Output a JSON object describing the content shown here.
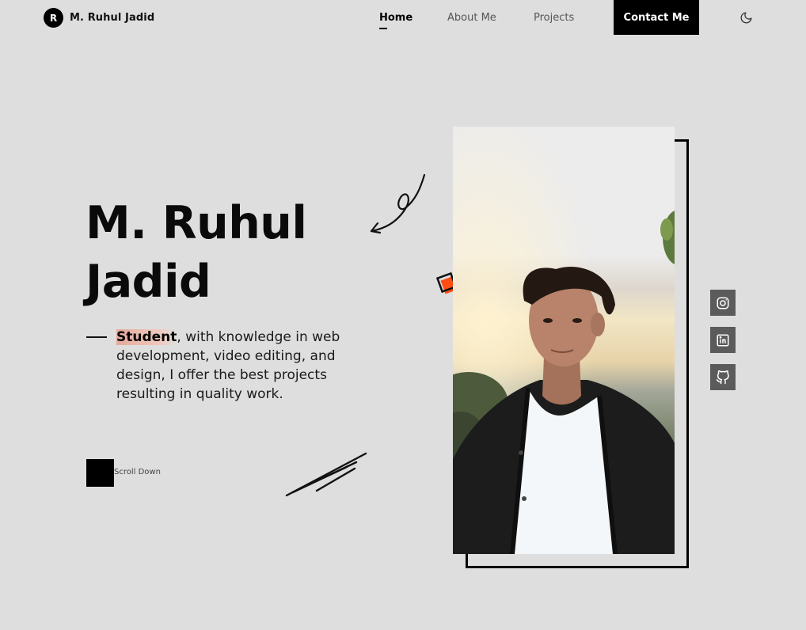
{
  "header": {
    "logo_letter": "R",
    "logo_name": "M. Ruhul Jadid",
    "nav": [
      {
        "label": "Home"
      },
      {
        "label": "About Me"
      },
      {
        "label": "Projects"
      }
    ],
    "contact_label": "Contact Me",
    "theme_icon": "moon-icon"
  },
  "hero": {
    "title_line1": "M. Ruhul",
    "title_line2": "Jadid",
    "highlight": "Student",
    "description": ", with knowledge in web development, video editing, and design, I offer the best projects resulting in quality work.",
    "scroll_label": "Scroll Down"
  },
  "social": [
    {
      "icon": "instagram-icon"
    },
    {
      "icon": "linkedin-icon"
    },
    {
      "icon": "github-icon"
    }
  ],
  "colors": {
    "background": "#dedede",
    "accent": "#ff4d14",
    "text": "#111111",
    "social_bg": "#5b5b5b"
  }
}
